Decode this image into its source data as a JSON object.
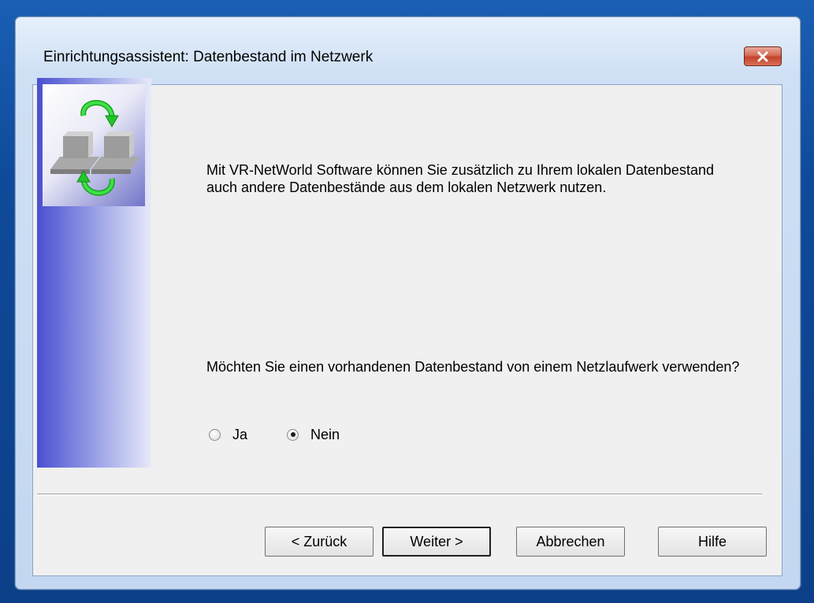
{
  "window": {
    "title": "Einrichtungsassistent: Datenbestand im Netzwerk",
    "close_icon": "close-icon"
  },
  "content": {
    "intro_text": "Mit VR-NetWorld Software können Sie zusätzlich zu Ihrem lokalen Datenbestand auch andere Datenbestände aus dem lokalen Netzwerk nutzen.",
    "question_text": "Möchten Sie einen vorhandenen Datenbestand von einem Netzlaufwerk verwenden?",
    "options": [
      {
        "label": "Ja",
        "selected": false
      },
      {
        "label": "Nein",
        "selected": true
      }
    ]
  },
  "buttons": {
    "back": "< Zurück",
    "next": "Weiter >",
    "cancel": "Abbrechen",
    "help": "Hilfe"
  },
  "colors": {
    "close_button": "#c4432a",
    "banner_dark": "#4a4fcf",
    "arrow_green": "#22c52a"
  }
}
